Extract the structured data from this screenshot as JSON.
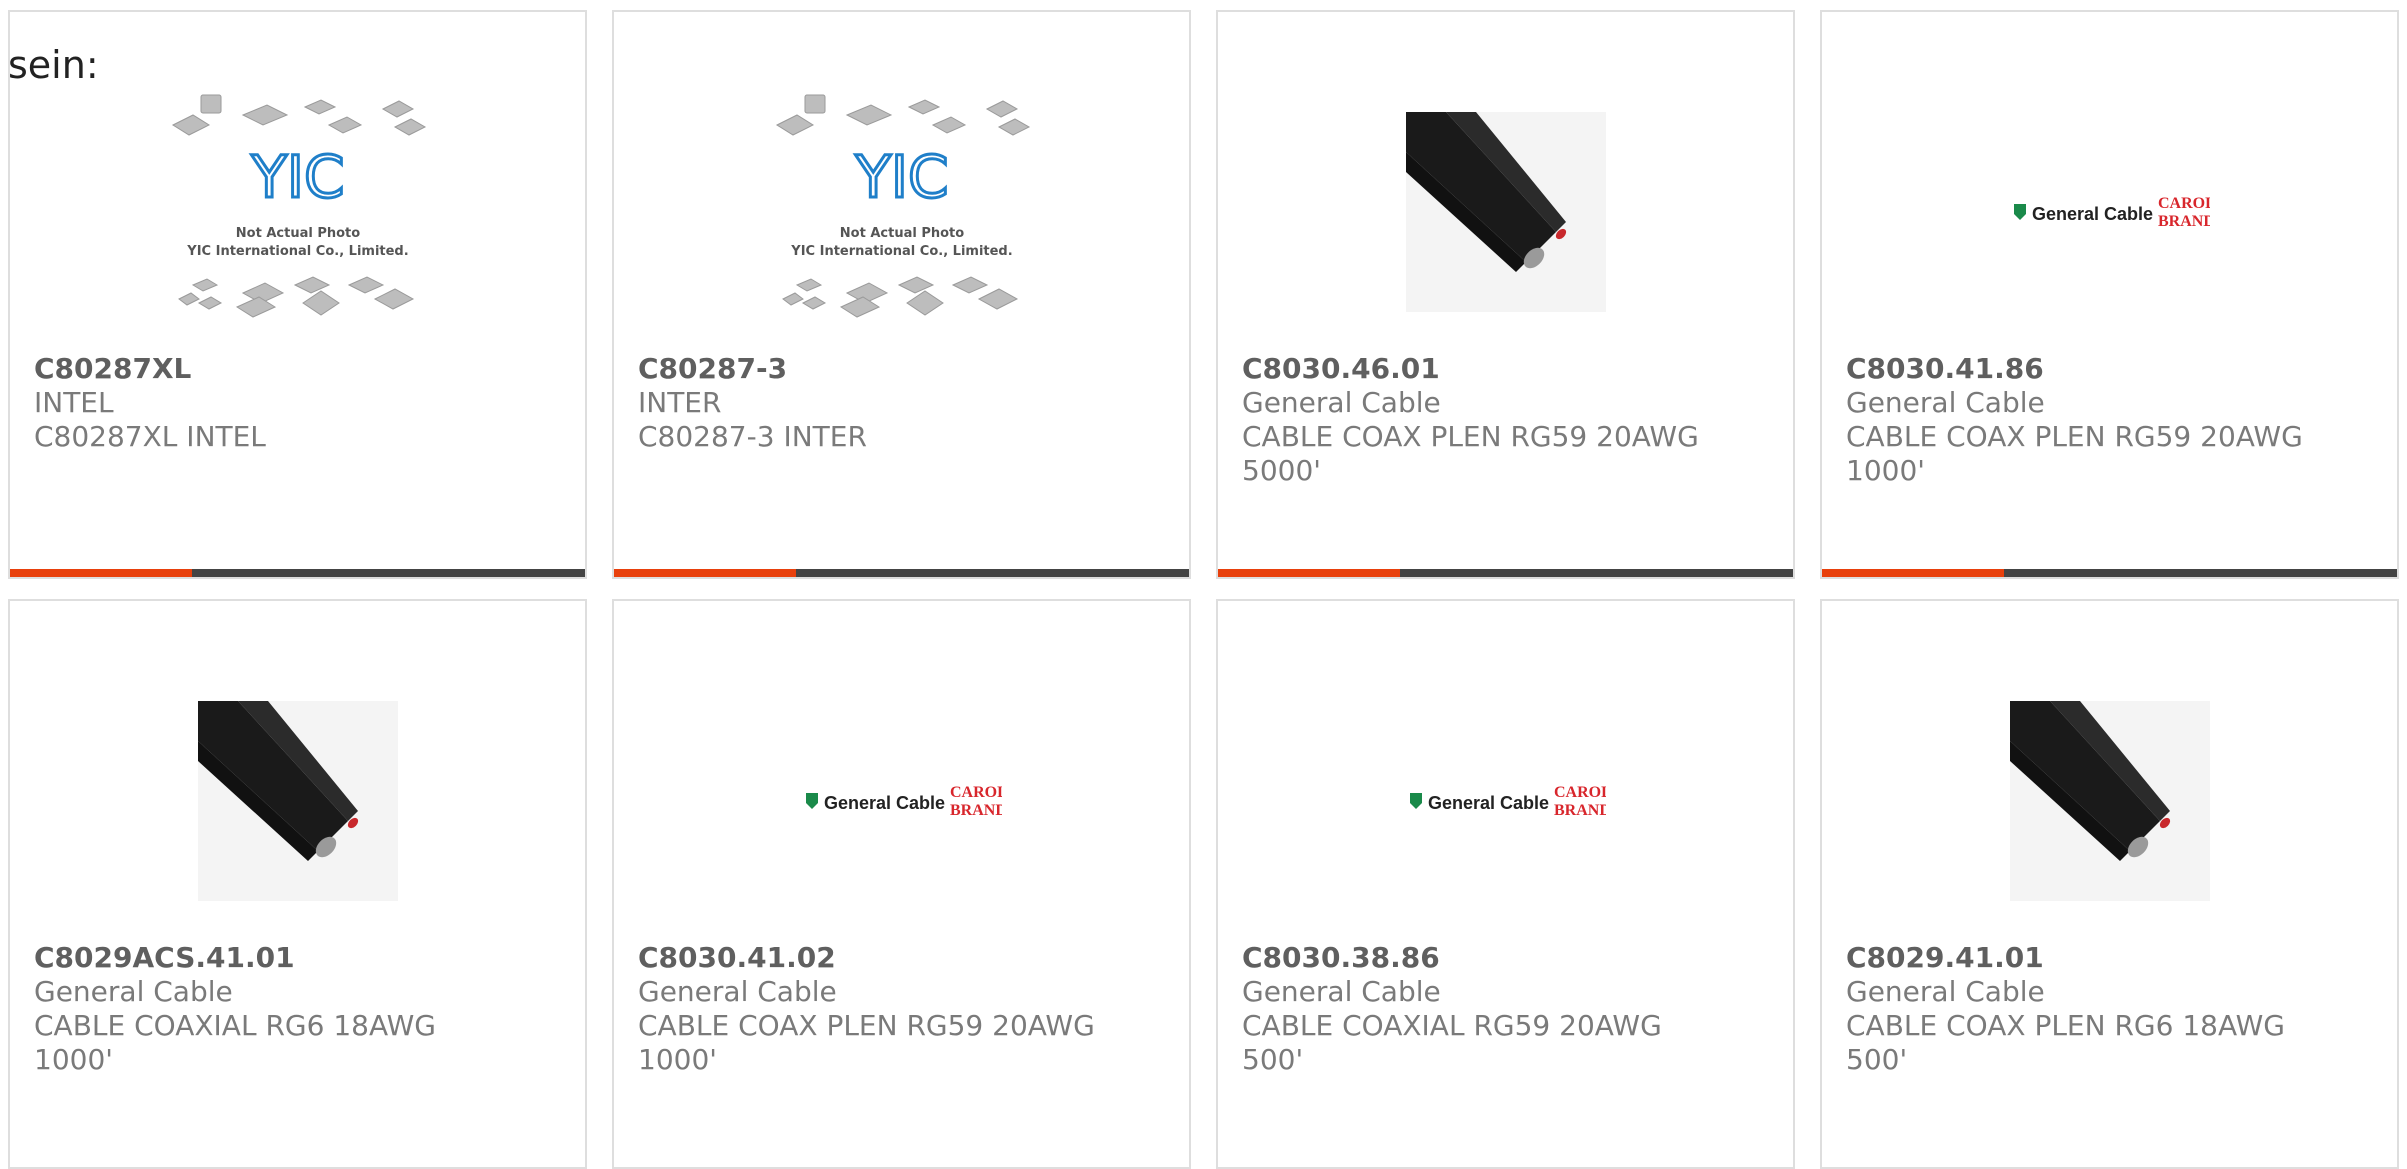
{
  "page_label": "sein:",
  "cards_row1": [
    {
      "part_number": "C80287XL",
      "manufacturer": "INTEL",
      "description_line1": "C80287XL INTEL",
      "description_line2": "",
      "image_type": "yic-placeholder",
      "image_caption_1": "Not Actual Photo",
      "image_caption_2": "YIC International Co., Limited.",
      "image_logo": "YIC"
    },
    {
      "part_number": "C80287-3",
      "manufacturer": "INTER",
      "description_line1": "C80287-3 INTER",
      "description_line2": "",
      "image_type": "yic-placeholder",
      "image_caption_1": "Not Actual Photo",
      "image_caption_2": "YIC International Co., Limited.",
      "image_logo": "YIC"
    },
    {
      "part_number": "C8030.46.01",
      "manufacturer": "General Cable",
      "description_line1": "CABLE COAX PLEN RG59 20AWG",
      "description_line2": "5000'",
      "image_type": "cable-photo"
    },
    {
      "part_number": "C8030.41.86",
      "manufacturer": "General Cable",
      "description_line1": "CABLE COAX PLEN RG59 20AWG",
      "description_line2": "1000'",
      "image_type": "brand-logo",
      "brand_name_1": "General Cable",
      "brand_name_2a": "CAROL",
      "brand_name_2b": "BRAND"
    }
  ],
  "cards_row2": [
    {
      "part_number": "C8029ACS.41.01",
      "manufacturer": "General Cable",
      "description_line1": "CABLE COAXIAL RG6 18AWG",
      "description_line2": "1000'",
      "image_type": "cable-photo"
    },
    {
      "part_number": "C8030.41.02",
      "manufacturer": "General Cable",
      "description_line1": "CABLE COAX PLEN RG59 20AWG",
      "description_line2": "1000'",
      "image_type": "brand-logo",
      "brand_name_1": "General Cable",
      "brand_name_2a": "CAROL",
      "brand_name_2b": "BRAND"
    },
    {
      "part_number": "C8030.38.86",
      "manufacturer": "General Cable",
      "description_line1": "CABLE COAXIAL RG59 20AWG",
      "description_line2": "500'",
      "image_type": "brand-logo",
      "brand_name_1": "General Cable",
      "brand_name_2a": "CAROL",
      "brand_name_2b": "BRAND"
    },
    {
      "part_number": "C8029.41.01",
      "manufacturer": "General Cable",
      "description_line1": "CABLE COAX PLEN RG6 18AWG",
      "description_line2": "500'",
      "image_type": "cable-photo"
    }
  ],
  "colors": {
    "accent": "#e8400c",
    "bar": "#444444",
    "border": "#dedede",
    "text": "#7a7a7a",
    "brand_green": "#1a8a4a",
    "brand_red": "#d8262c",
    "yic_blue": "#1f7fc9"
  }
}
